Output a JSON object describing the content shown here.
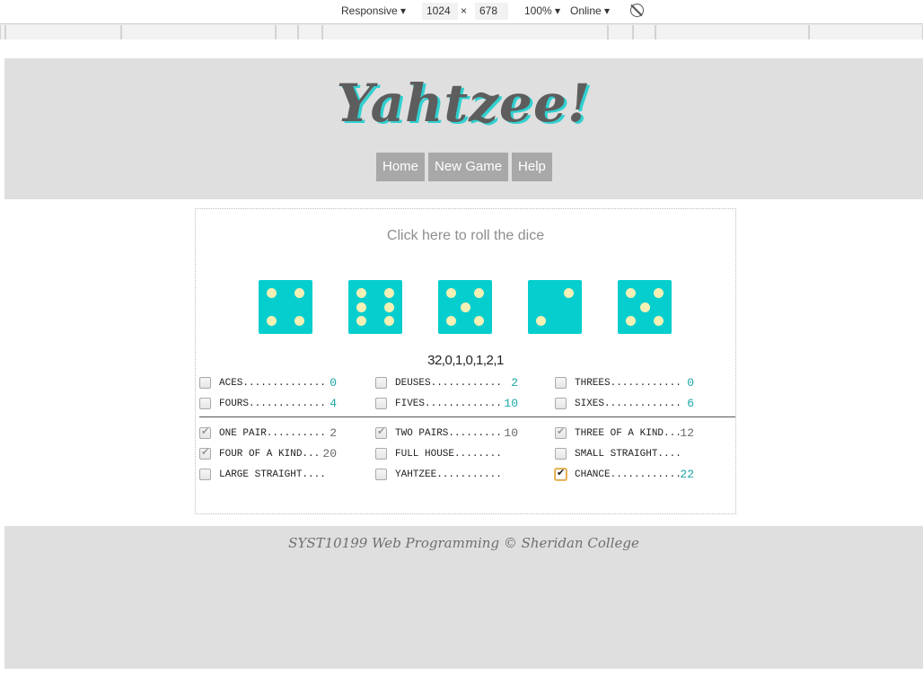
{
  "devtools": {
    "device": "Responsive",
    "width": "1024",
    "times": "×",
    "height": "678",
    "zoom": "100%",
    "network": "Online",
    "rotate_icon": "rotate-icon"
  },
  "app": {
    "title": "Yahtzee!",
    "nav": [
      "Home",
      "New Game",
      "Help"
    ],
    "roll_prompt": "Click here to roll the dice",
    "dice": [
      4,
      6,
      5,
      2,
      5
    ],
    "counts": "32,0,1,0,1,2,1",
    "upper": [
      {
        "label": "ACES..............",
        "value": "0",
        "checked": false
      },
      {
        "label": "DEUSES............",
        "value": "2",
        "checked": false
      },
      {
        "label": "THREES............",
        "value": "0",
        "checked": false
      },
      {
        "label": "FOURS.............",
        "value": "4",
        "checked": false
      },
      {
        "label": "FIVES.............",
        "value": "10",
        "checked": false
      },
      {
        "label": "SIXES.............",
        "value": "6",
        "checked": false
      }
    ],
    "lower": [
      {
        "label": "ONE PAIR..........",
        "value": "2",
        "checked": true
      },
      {
        "label": "TWO PAIRS.........",
        "value": "10",
        "checked": true
      },
      {
        "label": "THREE OF A KIND...",
        "value": "12",
        "checked": true
      },
      {
        "label": "FOUR OF A KIND...",
        "value": "20",
        "checked": true
      },
      {
        "label": "FULL HOUSE........",
        "value": "",
        "checked": false
      },
      {
        "label": "SMALL STRAIGHT....",
        "value": "",
        "checked": false
      },
      {
        "label": "LARGE STRAIGHT....",
        "value": "",
        "checked": false
      },
      {
        "label": "YAHTZEE...........",
        "value": "",
        "checked": false
      },
      {
        "label": "CHANCE............",
        "value": "22",
        "checked": true,
        "active": true
      }
    ],
    "footer": "SYST10199 Web Programming © Sheridan College",
    "colors": {
      "die": "#06cece",
      "pip": "#f5f0b4",
      "accent": "#1aa6a6",
      "nav_bg": "#a8a8a8"
    }
  }
}
